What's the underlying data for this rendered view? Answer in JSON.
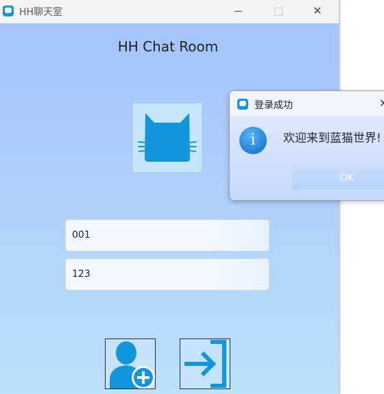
{
  "window": {
    "title": "HH聊天室",
    "app_icon": "chat-bubble-icon",
    "minimize_icon": "minimize-icon",
    "maximize_icon": "maximize-icon",
    "close_glyph": "✕"
  },
  "main": {
    "heading": "HH Chat Room",
    "avatar_icon": "cat-icon",
    "username_value": "001",
    "password_value": "123",
    "register_icon": "add-user-icon",
    "login_icon": "login-arrow-icon"
  },
  "dialog": {
    "title": "登录成功",
    "close_glyph": "✕",
    "info_glyph": "i",
    "message": "欢迎来到蓝猫世界!",
    "ok_label": "OK"
  },
  "colors": {
    "accent": "#1296db",
    "window_gradient_top": "#a3c3fb",
    "window_gradient_bottom": "#bbe1fb",
    "avatar_bg": "#c7e6fb"
  }
}
